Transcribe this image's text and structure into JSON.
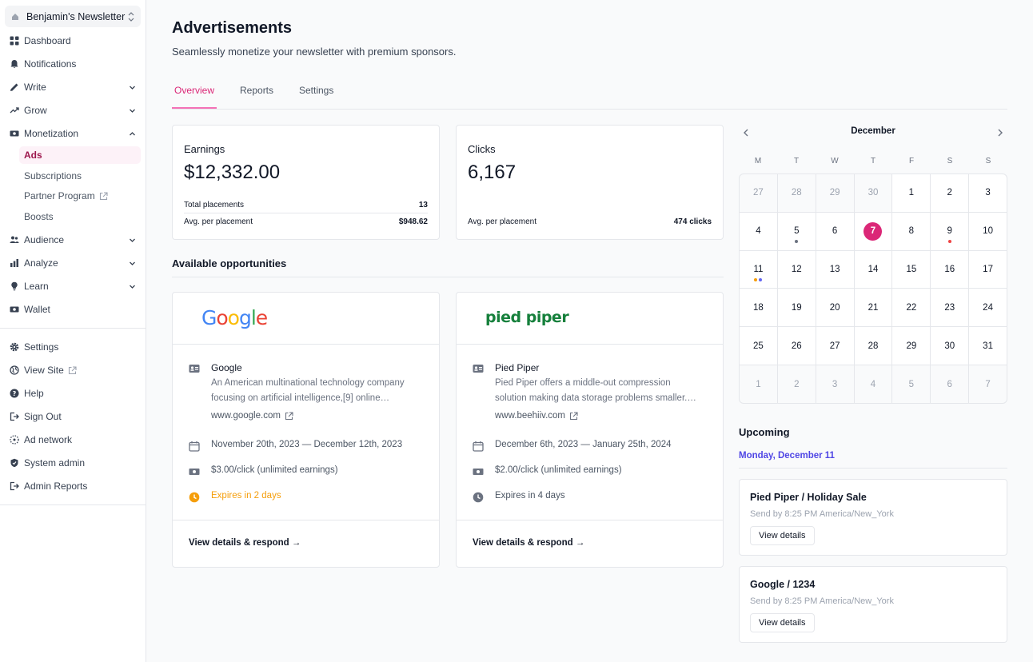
{
  "publication": {
    "name": "Benjamin's Newsletter"
  },
  "sidebar": {
    "items": [
      {
        "label": "Dashboard",
        "icon": "dashboard-icon"
      },
      {
        "label": "Notifications",
        "icon": "bell-icon"
      },
      {
        "label": "Write",
        "icon": "pencil-icon"
      },
      {
        "label": "Grow",
        "icon": "trending-up-icon"
      },
      {
        "label": "Monetization",
        "icon": "money-icon"
      },
      {
        "label": "Audience",
        "icon": "users-icon"
      },
      {
        "label": "Analyze",
        "icon": "bar-chart-icon"
      },
      {
        "label": "Learn",
        "icon": "lightbulb-icon"
      },
      {
        "label": "Wallet",
        "icon": "wallet-icon"
      }
    ],
    "monetization_sub": [
      "Ads",
      "Subscriptions",
      "Partner Program",
      "Boosts"
    ],
    "bottom_items": [
      {
        "label": "Settings",
        "icon": "gear-icon"
      },
      {
        "label": "View Site",
        "icon": "globe-icon"
      },
      {
        "label": "Help",
        "icon": "help-icon"
      },
      {
        "label": "Sign Out",
        "icon": "sign-out-icon"
      },
      {
        "label": "Ad network",
        "icon": "network-icon"
      },
      {
        "label": "System admin",
        "icon": "shield-icon"
      },
      {
        "label": "Admin Reports",
        "icon": "report-icon"
      }
    ]
  },
  "page": {
    "title": "Advertisements",
    "subtitle": "Seamlessly monetize your newsletter with premium sponsors.",
    "tabs": [
      "Overview",
      "Reports",
      "Settings"
    ]
  },
  "stats": {
    "earnings": {
      "label": "Earnings",
      "value": "$12,332.00",
      "rows": [
        {
          "label": "Total placements",
          "value": "13"
        },
        {
          "label": "Avg. per placement",
          "value": "$948.62"
        }
      ]
    },
    "clicks": {
      "label": "Clicks",
      "value": "6,167",
      "rows": [
        {
          "label": "Avg. per placement",
          "value": "474 clicks"
        }
      ]
    }
  },
  "opportunities": {
    "title": "Available opportunities",
    "items": [
      {
        "logo": "Google",
        "name": "Google",
        "description": "An American multinational technology company focusing on artificial intelligence,[9] online…",
        "url": "www.google.com",
        "dates": "November 20th, 2023 — December 12th, 2023",
        "rate": "$3.00/click (unlimited earnings)",
        "expires": "Expires in 2 days",
        "cta": "View details & respond →"
      },
      {
        "logo": "pied piper",
        "name": "Pied Piper",
        "description": "Pied Piper offers a middle-out compression solution making data storage problems smaller.…",
        "url": "www.beehiiv.com",
        "dates": "December 6th, 2023 — January 25th, 2024",
        "rate": "$2.00/click (unlimited earnings)",
        "expires": "Expires in 4 days",
        "cta": "View details & respond →"
      }
    ]
  },
  "calendar": {
    "month": "December",
    "weekdays": [
      "M",
      "T",
      "W",
      "T",
      "F",
      "S",
      "S"
    ],
    "weeks": [
      [
        "27",
        "28",
        "29",
        "30",
        "1",
        "2",
        "3"
      ],
      [
        "4",
        "5",
        "6",
        "7",
        "8",
        "9",
        "10"
      ],
      [
        "11",
        "12",
        "13",
        "14",
        "15",
        "16",
        "17"
      ],
      [
        "18",
        "19",
        "20",
        "21",
        "22",
        "23",
        "24"
      ],
      [
        "25",
        "26",
        "27",
        "28",
        "29",
        "30",
        "31"
      ],
      [
        "1",
        "2",
        "3",
        "4",
        "5",
        "6",
        "7"
      ]
    ],
    "selected": "7",
    "colors": {
      "accent": "#db2777",
      "gray_dot": "#6b7280",
      "red_dot": "#ef4444",
      "yellow_dot": "#f59e0b",
      "indigo_dot": "#6366f1"
    }
  },
  "upcoming": {
    "title": "Upcoming",
    "date": "Monday, December 11",
    "events": [
      {
        "title": "Pied Piper / Holiday Sale",
        "subtitle": "Send by 8:25 PM America/New_York",
        "button": "View details"
      },
      {
        "title": "Google / 1234",
        "subtitle": "Send by 8:25 PM America/New_York",
        "button": "View details"
      }
    ]
  }
}
